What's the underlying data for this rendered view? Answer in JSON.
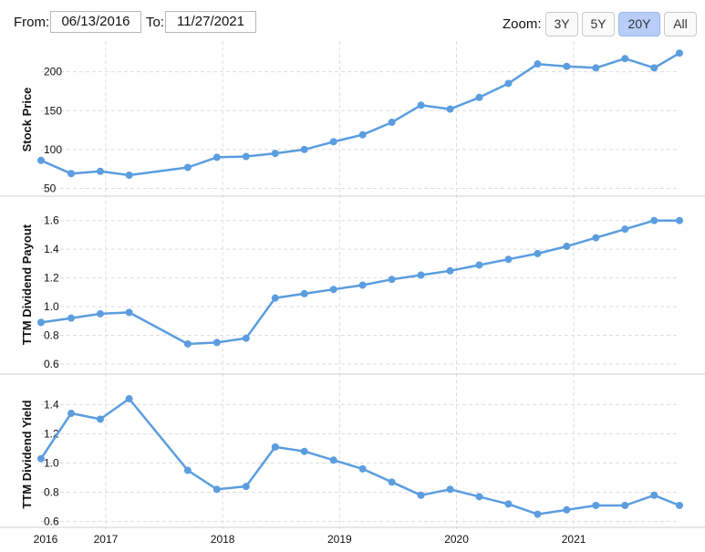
{
  "toolbar": {
    "from_label": "From:",
    "from_value": "06/13/2016",
    "to_label": "To:",
    "to_value": "11/27/2021",
    "zoom_label": "Zoom:",
    "zoom_buttons": [
      "3Y",
      "5Y",
      "20Y",
      "All"
    ],
    "zoom_active": "20Y"
  },
  "colors": {
    "line": "#5b9ddf",
    "grid": "#dddddd",
    "active_zoom": "#b8cdf8"
  },
  "chart_data": [
    {
      "type": "line",
      "ylabel": "Stock Price",
      "ylim": [
        40,
        236
      ],
      "yticks": [
        50,
        100,
        150,
        200
      ],
      "points": [
        [
          "2016-06-13",
          86
        ],
        [
          "2016-09-15",
          69
        ],
        [
          "2016-12-15",
          72
        ],
        [
          "2017-03-15",
          67
        ],
        [
          "2017-09-14",
          77
        ],
        [
          "2017-12-14",
          90
        ],
        [
          "2018-03-15",
          91
        ],
        [
          "2018-06-14",
          95
        ],
        [
          "2018-09-13",
          100
        ],
        [
          "2018-12-13",
          110
        ],
        [
          "2019-03-14",
          119
        ],
        [
          "2019-06-13",
          135
        ],
        [
          "2019-09-12",
          157
        ],
        [
          "2019-12-12",
          152
        ],
        [
          "2020-03-12",
          167
        ],
        [
          "2020-06-11",
          185
        ],
        [
          "2020-09-10",
          210
        ],
        [
          "2020-12-10",
          207
        ],
        [
          "2021-03-11",
          205
        ],
        [
          "2021-06-10",
          217
        ],
        [
          "2021-09-09",
          205
        ],
        [
          "2021-11-27",
          224
        ]
      ]
    },
    {
      "type": "line",
      "ylabel": "TTM Dividend Payout",
      "ylim": [
        0.53,
        1.7
      ],
      "yticks": [
        0.6,
        0.8,
        1.0,
        1.2,
        1.4,
        1.6
      ],
      "ytick_labels": [
        "0.6",
        "0.8",
        "1.0",
        "1.2",
        "1.4",
        "1.6"
      ],
      "points": [
        [
          "2016-06-13",
          0.89
        ],
        [
          "2016-09-15",
          0.92
        ],
        [
          "2016-12-15",
          0.95
        ],
        [
          "2017-03-15",
          0.96
        ],
        [
          "2017-09-14",
          0.74
        ],
        [
          "2017-12-14",
          0.75
        ],
        [
          "2018-03-15",
          0.78
        ],
        [
          "2018-06-14",
          1.06
        ],
        [
          "2018-09-13",
          1.09
        ],
        [
          "2018-12-13",
          1.12
        ],
        [
          "2019-03-14",
          1.15
        ],
        [
          "2019-06-13",
          1.19
        ],
        [
          "2019-09-12",
          1.22
        ],
        [
          "2019-12-12",
          1.25
        ],
        [
          "2020-03-12",
          1.29
        ],
        [
          "2020-06-11",
          1.33
        ],
        [
          "2020-09-10",
          1.37
        ],
        [
          "2020-12-10",
          1.42
        ],
        [
          "2021-03-11",
          1.48
        ],
        [
          "2021-06-10",
          1.54
        ],
        [
          "2021-09-09",
          1.6
        ],
        [
          "2021-11-27",
          1.6
        ]
      ]
    },
    {
      "type": "line",
      "ylabel": "TTM Dividend Yield",
      "ylim": [
        0.56,
        1.54
      ],
      "yticks": [
        0.6,
        0.8,
        1.0,
        1.2,
        1.4
      ],
      "ytick_labels": [
        "0.6",
        "0.8",
        "1.0",
        "1.2",
        "1.4"
      ],
      "points": [
        [
          "2016-06-13",
          1.03
        ],
        [
          "2016-09-15",
          1.34
        ],
        [
          "2016-12-15",
          1.3
        ],
        [
          "2017-03-15",
          1.44
        ],
        [
          "2017-09-14",
          0.95
        ],
        [
          "2017-12-14",
          0.82
        ],
        [
          "2018-03-15",
          0.84
        ],
        [
          "2018-06-14",
          1.11
        ],
        [
          "2018-09-13",
          1.08
        ],
        [
          "2018-12-13",
          1.02
        ],
        [
          "2019-03-14",
          0.96
        ],
        [
          "2019-06-13",
          0.87
        ],
        [
          "2019-09-12",
          0.78
        ],
        [
          "2019-12-12",
          0.82
        ],
        [
          "2020-03-12",
          0.77
        ],
        [
          "2020-06-11",
          0.72
        ],
        [
          "2020-09-10",
          0.65
        ],
        [
          "2020-12-10",
          0.68
        ],
        [
          "2021-03-11",
          0.71
        ],
        [
          "2021-06-10",
          0.71
        ],
        [
          "2021-09-09",
          0.78
        ],
        [
          "2021-11-27",
          0.71
        ]
      ]
    }
  ],
  "x_axis": {
    "range": [
      "2016-06-13",
      "2021-11-27"
    ],
    "ticks": [
      {
        "date": "2016-06-13",
        "label": "2016"
      },
      {
        "date": "2017-01-01",
        "label": "2017"
      },
      {
        "date": "2018-01-01",
        "label": "2018"
      },
      {
        "date": "2019-01-01",
        "label": "2019"
      },
      {
        "date": "2020-01-01",
        "label": "2020"
      },
      {
        "date": "2021-01-01",
        "label": "2021"
      }
    ]
  }
}
